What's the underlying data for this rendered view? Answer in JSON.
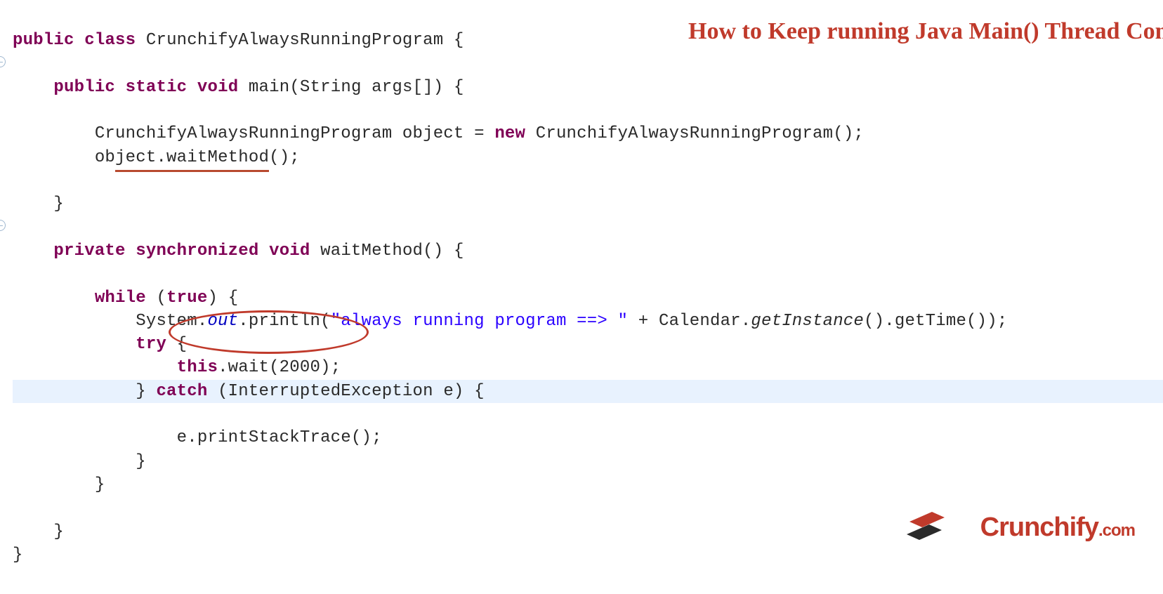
{
  "title": "How to Keep running Java Main() Thread Continuously?",
  "logo": {
    "brand": "Crunchify",
    "tld": ".com"
  },
  "code": {
    "kw_public": "public",
    "kw_class": "class",
    "kw_static": "static",
    "kw_void": "void",
    "kw_new": "new",
    "kw_private": "private",
    "kw_synchronized": "synchronized",
    "kw_while": "while",
    "kw_true": "true",
    "kw_try": "try",
    "kw_this": "this",
    "kw_catch": "catch",
    "class_name": "CrunchifyAlwaysRunningProgram",
    "class_brace": " {",
    "main_sig_1": "main(String args[]) {",
    "obj_decl_1": "CrunchifyAlwaysRunningProgram object = ",
    "obj_decl_2": " CrunchifyAlwaysRunningProgram();",
    "obj_call_prefix": "ob",
    "obj_call_under": "ject.waitMethod",
    "obj_call_suffix": "();",
    "close_brace": "}",
    "waitMethod_sig": "waitMethod() {",
    "while_open": " (",
    "while_close": ") {",
    "println_1": "System.",
    "println_out": "out",
    "println_2": ".println(",
    "str_literal": "\"always running program ==> \"",
    "println_3": " + Calendar.",
    "getInstance": "getInstance",
    "println_4": "().getTime());",
    "try_open": " {",
    "wait_call": ".wait(2000);",
    "catch_1": "} ",
    "catch_2": " (InterruptedException e) {",
    "stacktrace": "e.printStackTrace();"
  },
  "colors": {
    "accent": "#c03a2b",
    "keyword": "#7f0055",
    "string": "#2a00ff",
    "field": "#0000c0",
    "highlight": "#e8f2fe"
  }
}
